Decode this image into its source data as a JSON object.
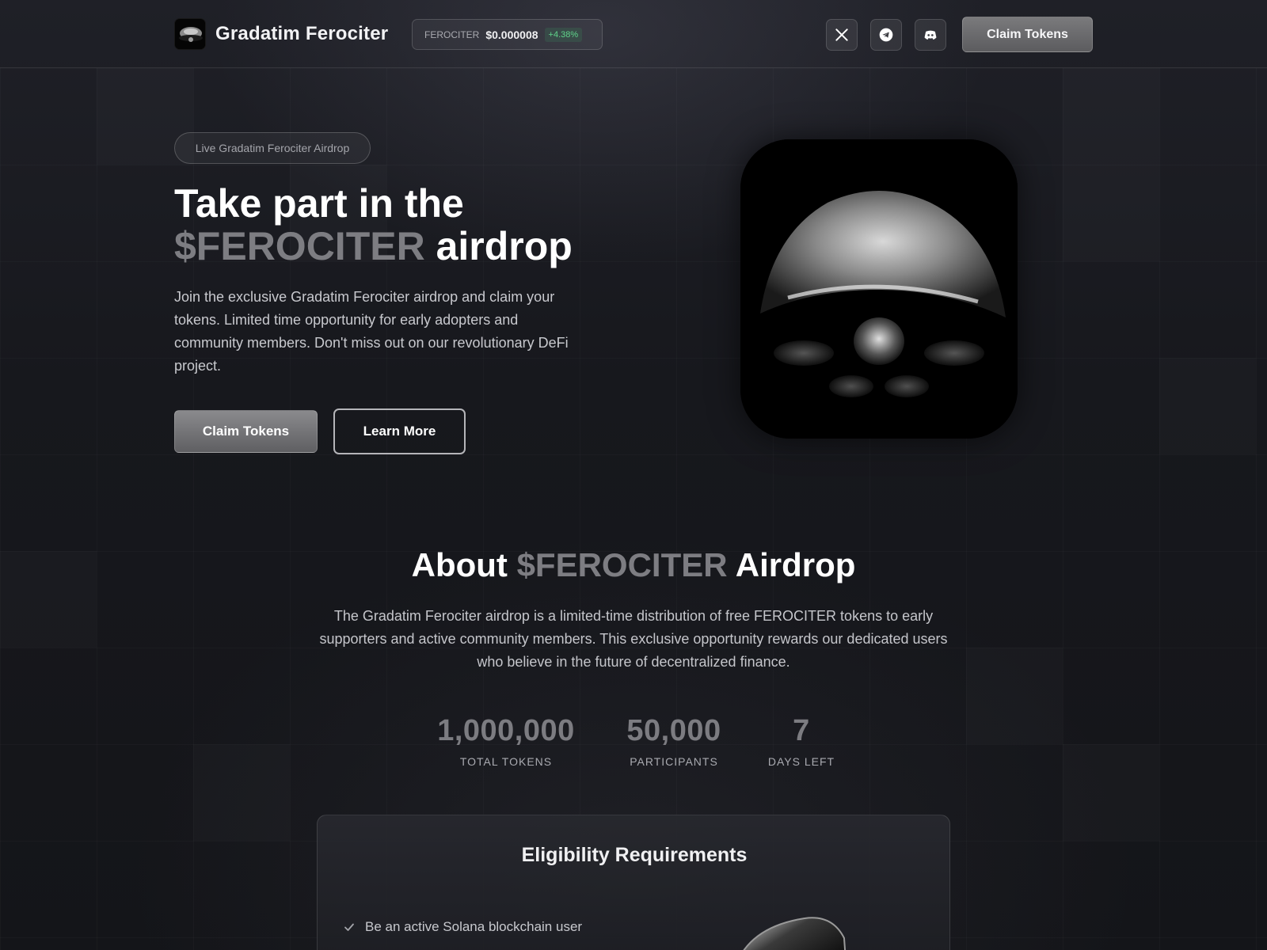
{
  "brand": {
    "name": "Gradatim Ferociter"
  },
  "ticker": {
    "symbol": "FEROCITER",
    "price": "$0.000008",
    "change": "+4.38%"
  },
  "social": [
    {
      "icon": "x-icon"
    },
    {
      "icon": "telegram-icon"
    },
    {
      "icon": "discord-icon"
    }
  ],
  "header": {
    "claim_label": "Claim Tokens"
  },
  "hero": {
    "badge": "Live Gradatim Ferociter Airdrop",
    "title_line1": "Take part in the",
    "title_highlight": "$FEROCITER",
    "title_end": "airdrop",
    "description": "Join the exclusive Gradatim Ferociter airdrop and claim your tokens. Limited time opportunity for early adopters and community members. Don't miss out on our revolutionary DeFi project.",
    "primary_button": "Claim Tokens",
    "secondary_button": "Learn More"
  },
  "about": {
    "title_start": "About",
    "title_highlight": "$FEROCITER",
    "title_end": "Airdrop",
    "description": "The Gradatim Ferociter airdrop is a limited-time distribution of free FEROCITER tokens to early supporters and active community members. This exclusive opportunity rewards our dedicated users who believe in the future of decentralized finance.",
    "stats": [
      {
        "value": "1,000,000",
        "label": "TOTAL TOKENS"
      },
      {
        "value": "50,000",
        "label": "PARTICIPANTS"
      },
      {
        "value": "7",
        "label": "DAYS LEFT"
      }
    ]
  },
  "eligibility": {
    "title": "Eligibility Requirements",
    "items": [
      "Be an active Solana blockchain user"
    ]
  },
  "colors": {
    "background": "#15161a",
    "accent_gray": "#7d7d82",
    "positive": "#5fd38a"
  }
}
